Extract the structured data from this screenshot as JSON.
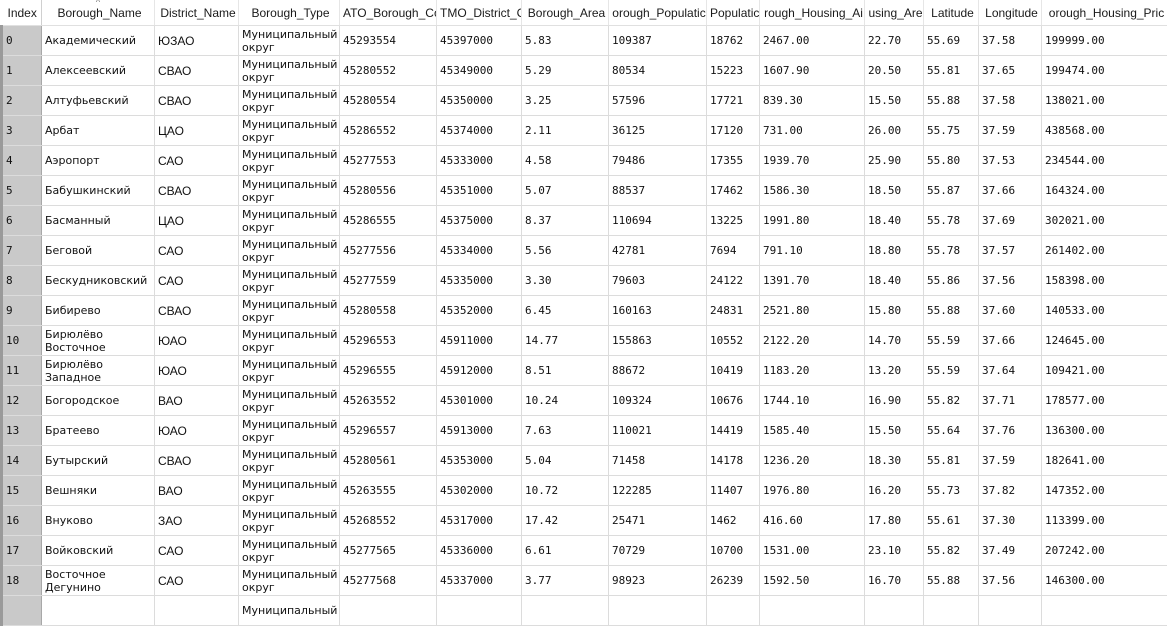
{
  "table": {
    "columns": [
      "Index",
      "Borough_Name",
      "District_Name",
      "Borough_Type",
      "ATO_Borough_Co",
      "TMO_District_C",
      "Borough_Area",
      "orough_Populatic",
      "Populatic",
      "rough_Housing_Ai",
      "using_Are",
      "Latitude",
      "Longitude",
      "orough_Housing_Pric"
    ],
    "sort_column": "Borough_Name",
    "rows": [
      [
        "0",
        "Академический",
        "ЮЗАО",
        "Муниципальный округ",
        "45293554",
        "45397000",
        "5.83",
        "109387",
        "18762",
        "2467.00",
        "22.70",
        "55.69",
        "37.58",
        "199999.00"
      ],
      [
        "1",
        "Алексеевский",
        "СВАО",
        "Муниципальный округ",
        "45280552",
        "45349000",
        "5.29",
        "80534",
        "15223",
        "1607.90",
        "20.50",
        "55.81",
        "37.65",
        "199474.00"
      ],
      [
        "2",
        "Алтуфьевский",
        "СВАО",
        "Муниципальный округ",
        "45280554",
        "45350000",
        "3.25",
        "57596",
        "17721",
        "839.30",
        "15.50",
        "55.88",
        "37.58",
        "138021.00"
      ],
      [
        "3",
        "Арбат",
        "ЦАО",
        "Муниципальный округ",
        "45286552",
        "45374000",
        "2.11",
        "36125",
        "17120",
        "731.00",
        "26.00",
        "55.75",
        "37.59",
        "438568.00"
      ],
      [
        "4",
        "Аэропорт",
        "САО",
        "Муниципальный округ",
        "45277553",
        "45333000",
        "4.58",
        "79486",
        "17355",
        "1939.70",
        "25.90",
        "55.80",
        "37.53",
        "234544.00"
      ],
      [
        "5",
        "Бабушкинский",
        "СВАО",
        "Муниципальный округ",
        "45280556",
        "45351000",
        "5.07",
        "88537",
        "17462",
        "1586.30",
        "18.50",
        "55.87",
        "37.66",
        "164324.00"
      ],
      [
        "6",
        "Басманный",
        "ЦАО",
        "Муниципальный округ",
        "45286555",
        "45375000",
        "8.37",
        "110694",
        "13225",
        "1991.80",
        "18.40",
        "55.78",
        "37.69",
        "302021.00"
      ],
      [
        "7",
        "Беговой",
        "САО",
        "Муниципальный округ",
        "45277556",
        "45334000",
        "5.56",
        "42781",
        "7694",
        "791.10",
        "18.80",
        "55.78",
        "37.57",
        "261402.00"
      ],
      [
        "8",
        "Бескудниковский",
        "САО",
        "Муниципальный округ",
        "45277559",
        "45335000",
        "3.30",
        "79603",
        "24122",
        "1391.70",
        "18.40",
        "55.86",
        "37.56",
        "158398.00"
      ],
      [
        "9",
        "Бибирево",
        "СВАО",
        "Муниципальный округ",
        "45280558",
        "45352000",
        "6.45",
        "160163",
        "24831",
        "2521.80",
        "15.80",
        "55.88",
        "37.60",
        "140533.00"
      ],
      [
        "10",
        "Бирюлёво Восточное",
        "ЮАО",
        "Муниципальный округ",
        "45296553",
        "45911000",
        "14.77",
        "155863",
        "10552",
        "2122.20",
        "14.70",
        "55.59",
        "37.66",
        "124645.00"
      ],
      [
        "11",
        "Бирюлёво Западное",
        "ЮАО",
        "Муниципальный округ",
        "45296555",
        "45912000",
        "8.51",
        "88672",
        "10419",
        "1183.20",
        "13.20",
        "55.59",
        "37.64",
        "109421.00"
      ],
      [
        "12",
        "Богородское",
        "ВАО",
        "Муниципальный округ",
        "45263552",
        "45301000",
        "10.24",
        "109324",
        "10676",
        "1744.10",
        "16.90",
        "55.82",
        "37.71",
        "178577.00"
      ],
      [
        "13",
        "Братеево",
        "ЮАО",
        "Муниципальный округ",
        "45296557",
        "45913000",
        "7.63",
        "110021",
        "14419",
        "1585.40",
        "15.50",
        "55.64",
        "37.76",
        "136300.00"
      ],
      [
        "14",
        "Бутырский",
        "СВАО",
        "Муниципальный округ",
        "45280561",
        "45353000",
        "5.04",
        "71458",
        "14178",
        "1236.20",
        "18.30",
        "55.81",
        "37.59",
        "182641.00"
      ],
      [
        "15",
        "Вешняки",
        "ВАО",
        "Муниципальный округ",
        "45263555",
        "45302000",
        "10.72",
        "122285",
        "11407",
        "1976.80",
        "16.20",
        "55.73",
        "37.82",
        "147352.00"
      ],
      [
        "16",
        "Внуково",
        "ЗАО",
        "Муниципальный округ",
        "45268552",
        "45317000",
        "17.42",
        "25471",
        "1462",
        "416.60",
        "17.80",
        "55.61",
        "37.30",
        "113399.00"
      ],
      [
        "17",
        "Войковский",
        "САО",
        "Муниципальный округ",
        "45277565",
        "45336000",
        "6.61",
        "70729",
        "10700",
        "1531.00",
        "23.10",
        "55.82",
        "37.49",
        "207242.00"
      ],
      [
        "18",
        "Восточное Дегунино",
        "САО",
        "Муниципальный округ",
        "45277568",
        "45337000",
        "3.77",
        "98923",
        "26239",
        "1592.50",
        "16.70",
        "55.88",
        "37.56",
        "146300.00"
      ],
      [
        "",
        "",
        "",
        "Муниципальный",
        "",
        "",
        "",
        "",
        "",
        "",
        "",
        "",
        "",
        ""
      ]
    ]
  }
}
